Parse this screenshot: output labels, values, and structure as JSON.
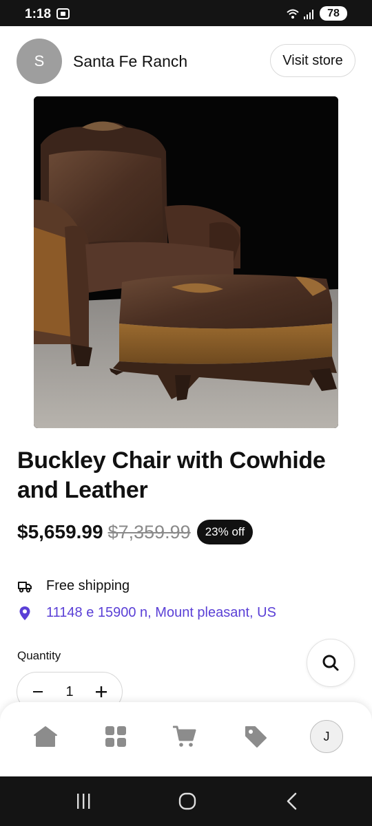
{
  "status_bar": {
    "time": "1:18",
    "battery": "78"
  },
  "store": {
    "avatar_initial": "S",
    "name": "Santa Fe Ranch",
    "visit_label": "Visit store"
  },
  "product": {
    "image_subject": "leather-chair-and-ottoman",
    "title": "Buckley Chair with Cowhide and Leather",
    "price_current": "$5,659.99",
    "price_original": "$7,359.99",
    "discount": "23% off",
    "shipping": "Free shipping",
    "location": "11148 e 15900 n, Mount pleasant, US"
  },
  "quantity": {
    "label": "Quantity",
    "value": "1",
    "decrement_icon": "minus-icon",
    "increment_icon": "plus-icon"
  },
  "colors": {
    "accent_link": "#5a3fd6",
    "badge_bg": "#111111",
    "icon_gray": "#8c8c8c"
  },
  "bottom_nav": {
    "items": [
      {
        "icon": "home-icon"
      },
      {
        "icon": "grid-icon"
      },
      {
        "icon": "cart-icon"
      },
      {
        "icon": "tag-icon"
      },
      {
        "icon": "account-avatar",
        "initial": "J"
      }
    ]
  }
}
